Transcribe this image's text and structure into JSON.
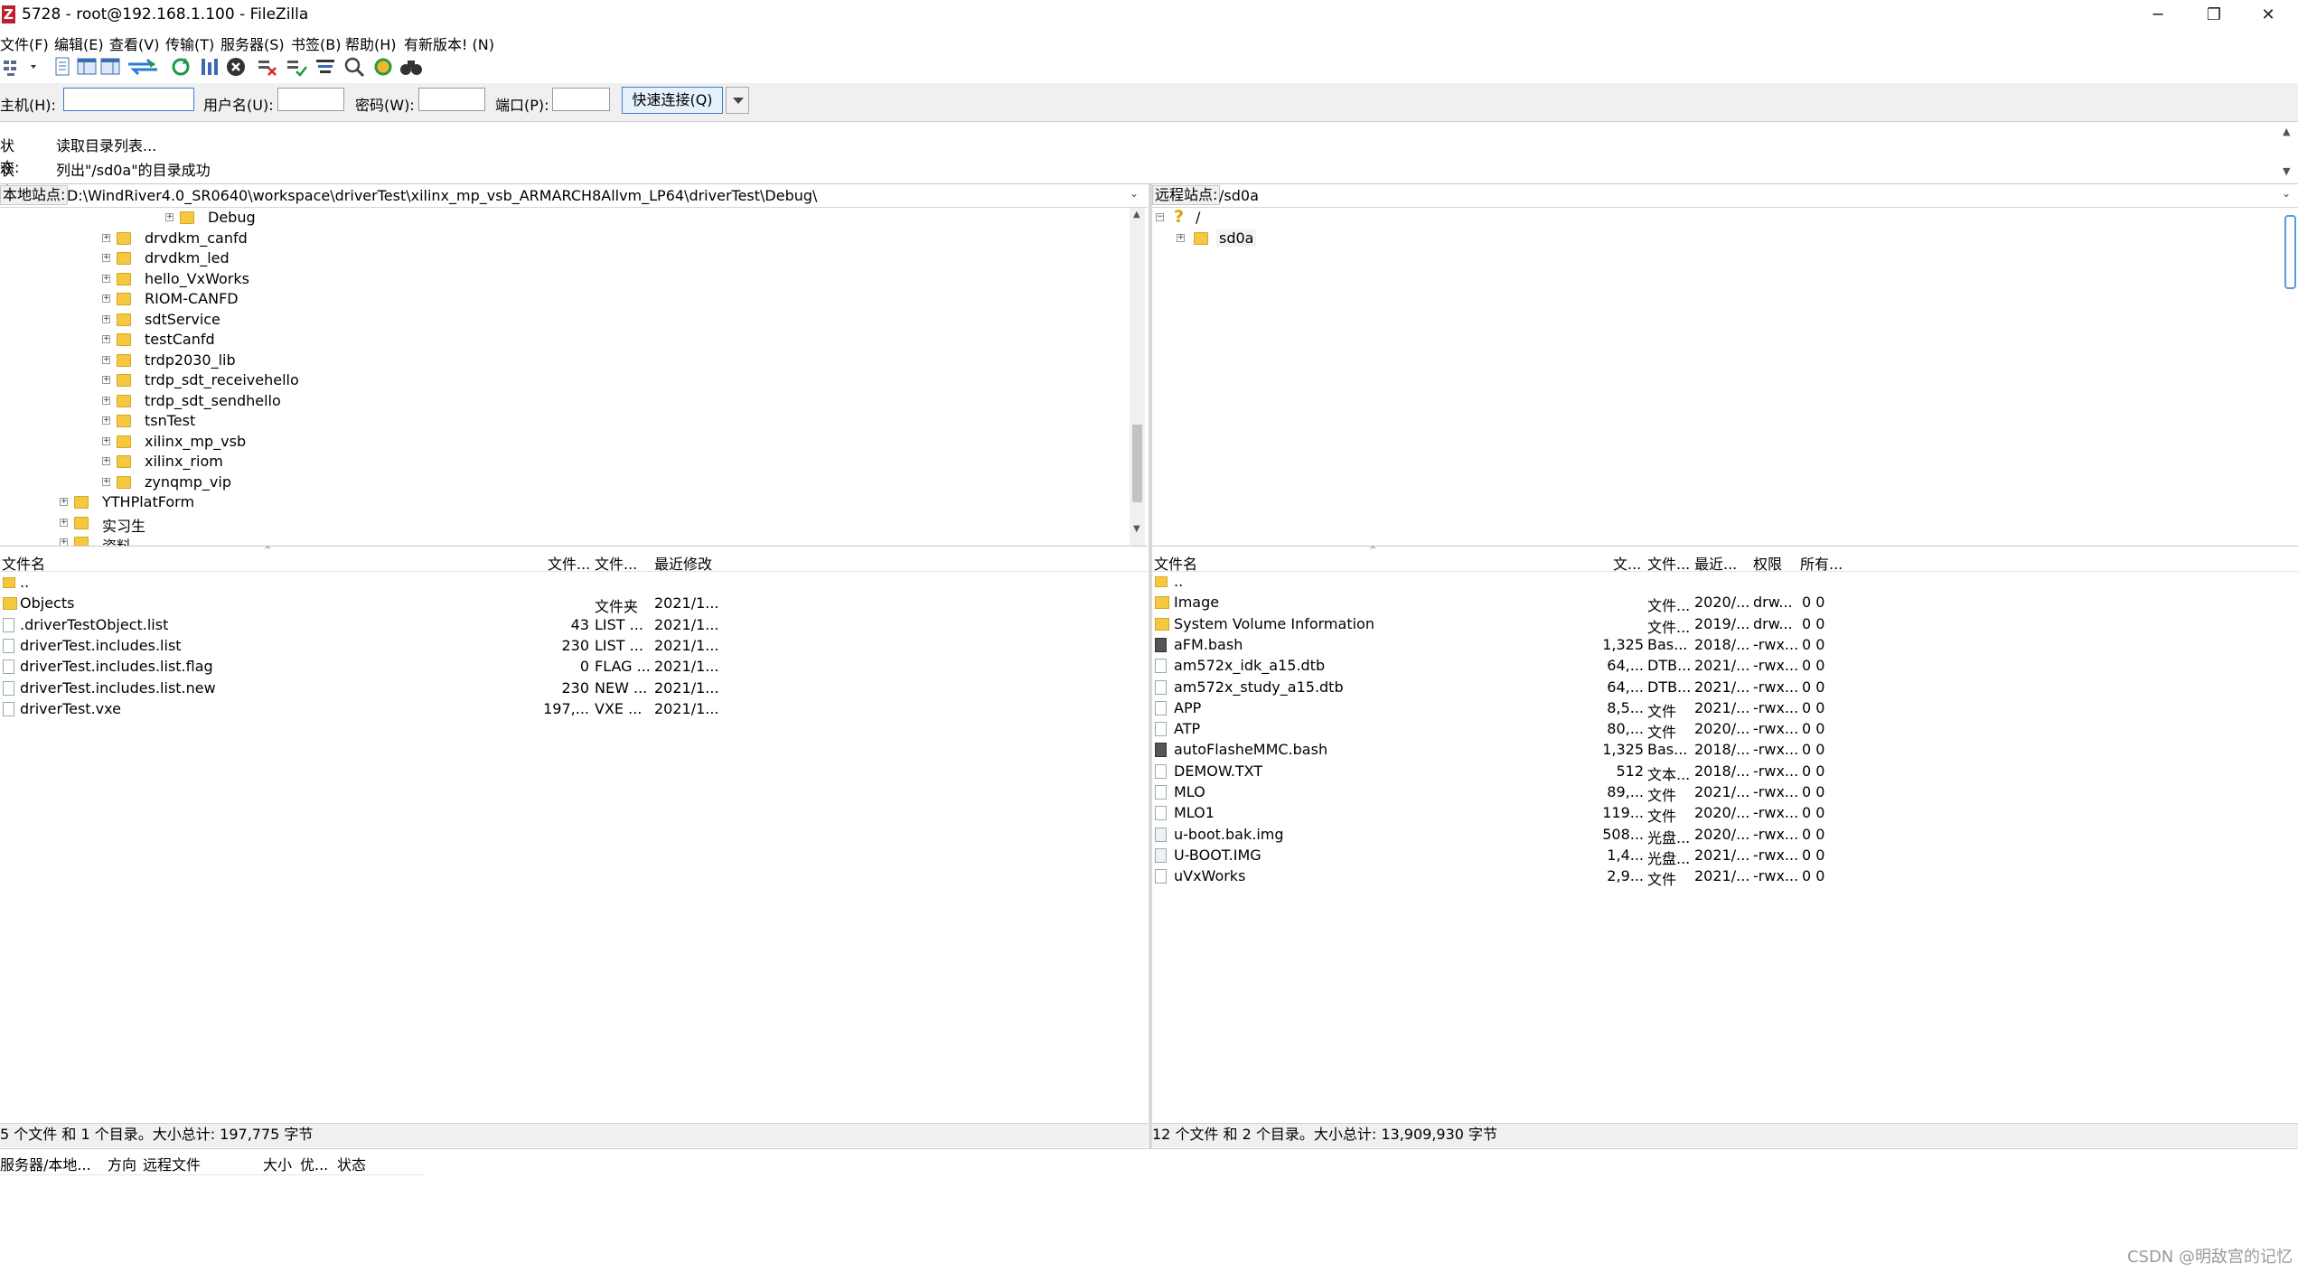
{
  "window": {
    "title": "5728 - root@192.168.1.100 - FileZilla",
    "app_icon_letter": "Z",
    "controls": [
      "─",
      "❐",
      "✕"
    ]
  },
  "menu": [
    "文件(F)",
    "编辑(E)",
    "查看(V)",
    "传输(T)",
    "服务器(S)",
    "书签(B)",
    "帮助(H)",
    "有新版本! (N)"
  ],
  "toolbar": {
    "icons": [
      "site-manager-icon",
      "toggle-log-icon",
      "toggle-local-tree-icon",
      "toggle-remote-tree-icon",
      "toggle-queue-icon",
      "refresh-icon",
      "process-queue-icon",
      "cancel-icon",
      "disconnect-icon",
      "reconnect-icon",
      "filter-icon",
      "compare-icon",
      "sync-browse-icon",
      "search-icon"
    ]
  },
  "quickconnect": {
    "host_label": "主机(H):",
    "user_label": "用户名(U):",
    "pass_label": "密码(W):",
    "port_label": "端口(P):",
    "host_value": "",
    "user_value": "",
    "pass_value": "",
    "port_value": "",
    "button": "快速连接(Q)"
  },
  "log": [
    {
      "label": "状态:",
      "message": "读取目录列表..."
    },
    {
      "label": "状态:",
      "message": "列出\"/sd0a\"的目录成功"
    }
  ],
  "local": {
    "path_label": "本地站点:",
    "path": "D:\\WindRiver4.0_SR0640\\workspace\\driverTest\\xilinx_mp_vsb_ARMARCH8Allvm_LP64\\driverTest\\Debug\\",
    "tree": [
      {
        "label": "Debug",
        "level": 4
      },
      {
        "label": "drvdkm_canfd",
        "level": 2
      },
      {
        "label": "drvdkm_led",
        "level": 2
      },
      {
        "label": "hello_VxWorks",
        "level": 2
      },
      {
        "label": "RIOM-CANFD",
        "level": 2
      },
      {
        "label": "sdtService",
        "level": 2
      },
      {
        "label": "testCanfd",
        "level": 2
      },
      {
        "label": "trdp2030_lib",
        "level": 2
      },
      {
        "label": "trdp_sdt_receivehello",
        "level": 2
      },
      {
        "label": "trdp_sdt_sendhello",
        "level": 2
      },
      {
        "label": "tsnTest",
        "level": 2
      },
      {
        "label": "xilinx_mp_vsb",
        "level": 2
      },
      {
        "label": "xilinx_riom",
        "level": 2
      },
      {
        "label": "zynqmp_vip",
        "level": 2
      },
      {
        "label": "YTHPlatForm",
        "level": 1
      },
      {
        "label": "实习生",
        "level": 1
      },
      {
        "label": "资料",
        "level": 1
      }
    ],
    "columns": [
      "文件名",
      "文件...",
      "文件...",
      "最近修改"
    ],
    "files": [
      {
        "name": "..",
        "size": "",
        "type": "",
        "modified": "",
        "icon": "up"
      },
      {
        "name": "Objects",
        "size": "",
        "type": "文件夹",
        "modified": "2021/1...",
        "icon": "folder"
      },
      {
        "name": ".driverTestObject.list",
        "size": "43",
        "type": "LIST ...",
        "modified": "2021/1...",
        "icon": "file"
      },
      {
        "name": "driverTest.includes.list",
        "size": "230",
        "type": "LIST ...",
        "modified": "2021/1...",
        "icon": "file"
      },
      {
        "name": "driverTest.includes.list.flag",
        "size": "0",
        "type": "FLAG ...",
        "modified": "2021/1...",
        "icon": "file"
      },
      {
        "name": "driverTest.includes.list.new",
        "size": "230",
        "type": "NEW ...",
        "modified": "2021/1...",
        "icon": "file"
      },
      {
        "name": "driverTest.vxe",
        "size": "197,...",
        "type": "VXE ...",
        "modified": "2021/1...",
        "icon": "file"
      }
    ],
    "status": "5 个文件 和 1 个目录。大小总计: 197,775 字节"
  },
  "remote": {
    "path_label": "远程站点:",
    "path": "/sd0a",
    "tree": [
      {
        "label": "/",
        "level": 0
      },
      {
        "label": "sd0a",
        "level": 1
      }
    ],
    "columns": [
      "文件名",
      "文...",
      "文件...",
      "最近...",
      "权限",
      "所有..."
    ],
    "files": [
      {
        "name": "..",
        "size": "",
        "type": "",
        "modified": "",
        "perm": "",
        "owner": "",
        "icon": "up"
      },
      {
        "name": "Image",
        "size": "",
        "type": "文件...",
        "modified": "2020/...",
        "perm": "drw...",
        "owner": "0 0",
        "icon": "folder"
      },
      {
        "name": "System Volume Information",
        "size": "",
        "type": "文件...",
        "modified": "2019/...",
        "perm": "drw...",
        "owner": "0 0",
        "icon": "folder"
      },
      {
        "name": "aFM.bash",
        "size": "1,325",
        "type": "Bas...",
        "modified": "2018/...",
        "perm": "-rwx...",
        "owner": "0 0",
        "icon": "bash"
      },
      {
        "name": "am572x_idk_a15.dtb",
        "size": "64,...",
        "type": "DTB...",
        "modified": "2021/...",
        "perm": "-rwx...",
        "owner": "0 0",
        "icon": "file"
      },
      {
        "name": "am572x_study_a15.dtb",
        "size": "64,...",
        "type": "DTB...",
        "modified": "2021/...",
        "perm": "-rwx...",
        "owner": "0 0",
        "icon": "file"
      },
      {
        "name": "APP",
        "size": "8,5...",
        "type": "文件",
        "modified": "2021/...",
        "perm": "-rwx...",
        "owner": "0 0",
        "icon": "file"
      },
      {
        "name": "ATP",
        "size": "80,...",
        "type": "文件",
        "modified": "2020/...",
        "perm": "-rwx...",
        "owner": "0 0",
        "icon": "file"
      },
      {
        "name": "autoFlasheMMC.bash",
        "size": "1,325",
        "type": "Bas...",
        "modified": "2018/...",
        "perm": "-rwx...",
        "owner": "0 0",
        "icon": "bash"
      },
      {
        "name": "DEMOW.TXT",
        "size": "512",
        "type": "文本...",
        "modified": "2018/...",
        "perm": "-rwx...",
        "owner": "0 0",
        "icon": "file"
      },
      {
        "name": "MLO",
        "size": "89,...",
        "type": "文件",
        "modified": "2021/...",
        "perm": "-rwx...",
        "owner": "0 0",
        "icon": "file"
      },
      {
        "name": "MLO1",
        "size": "119...",
        "type": "文件",
        "modified": "2020/...",
        "perm": "-rwx...",
        "owner": "0 0",
        "icon": "file"
      },
      {
        "name": "u-boot.bak.img",
        "size": "508...",
        "type": "光盘...",
        "modified": "2020/...",
        "perm": "-rwx...",
        "owner": "0 0",
        "icon": "img"
      },
      {
        "name": "U-BOOT.IMG",
        "size": "1,4...",
        "type": "光盘...",
        "modified": "2021/...",
        "perm": "-rwx...",
        "owner": "0 0",
        "icon": "img"
      },
      {
        "name": "uVxWorks",
        "size": "2,9...",
        "type": "文件",
        "modified": "2021/...",
        "perm": "-rwx...",
        "owner": "0 0",
        "icon": "file"
      }
    ],
    "status": "12 个文件 和 2 个目录。大小总计: 13,909,930 字节"
  },
  "queue": {
    "columns": [
      "服务器/本地...",
      "方向",
      "远程文件",
      "大小",
      "优...",
      "状态"
    ]
  },
  "watermark": "CSDN @明敌宫的记忆"
}
